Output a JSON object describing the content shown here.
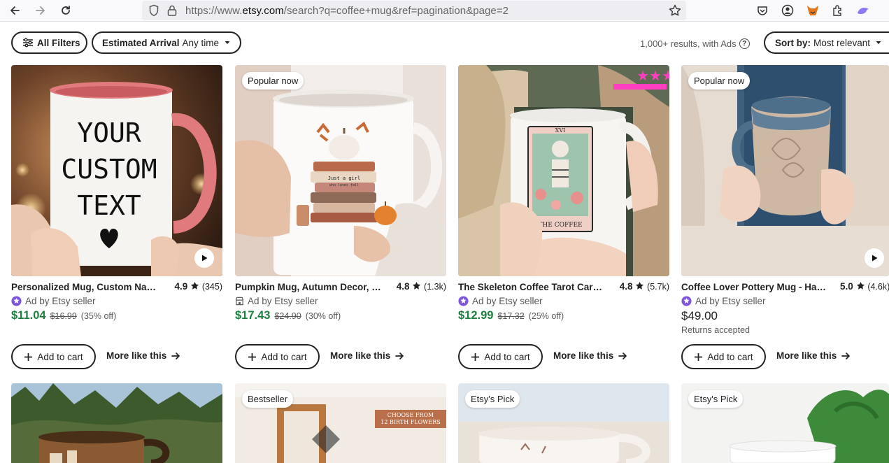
{
  "browser": {
    "url_prefix": "https://www.",
    "url_host": "etsy.com",
    "url_path": "/search?q=coffee+mug&ref=pagination&page=2"
  },
  "filters": {
    "all_filters": "All Filters",
    "arrival_label": "Estimated Arrival",
    "arrival_value": "Any time",
    "results_text": "1,000+ results, with Ads",
    "results_help": "?",
    "sort_label": "Sort by:",
    "sort_value": "Most relevant"
  },
  "listings": [
    {
      "title": "Personalized Mug, Custom Name Mug",
      "rating": "4.9",
      "reviews": "(345)",
      "seller_line": "Ad by Etsy seller",
      "price": "$11.04",
      "original_price": "$16.99",
      "discount": "(35% off)",
      "add_to_cart": "Add to cart",
      "more_like_this": "More like this",
      "mug_text": [
        "YOUR",
        "CUSTOM",
        "TEXT"
      ]
    },
    {
      "badge": "Popular now",
      "title": "Pumpkin Mug, Autumn Decor, Fall Mug",
      "rating": "4.8",
      "reviews": "(1.3k)",
      "seller_line": "Ad by Etsy seller",
      "price": "$17.43",
      "original_price": "$24.90",
      "discount": "(30% off)",
      "add_to_cart": "Add to cart",
      "more_like_this": "More like this",
      "mug_text": [
        "Just a girl",
        "who loves fall"
      ]
    },
    {
      "title": "The Skeleton Coffee Tarot Card Mug",
      "rating": "4.8",
      "reviews": "(5.7k)",
      "seller_line": "Ad by Etsy seller",
      "price": "$12.99",
      "original_price": "$17.32",
      "discount": "(25% off)",
      "add_to_cart": "Add to cart",
      "more_like_this": "More like this",
      "mug_text": [
        "XVI",
        "THE COFFEE"
      ]
    },
    {
      "badge": "Popular now",
      "title": "Coffee Lover Pottery Mug - Handmade",
      "rating": "5.0",
      "reviews": "(4.6k)",
      "seller_line": "Ad by Etsy seller",
      "price": "$49.00",
      "note": "Returns accepted",
      "add_to_cart": "Add to cart",
      "more_like_this": "More like this"
    }
  ],
  "second_row": [
    {
      "badge": ""
    },
    {
      "badge": "Bestseller",
      "overlay_text": [
        "CHOOSE FROM",
        "12 BIRTH FLOWERS"
      ]
    },
    {
      "badge": "Etsy's Pick"
    },
    {
      "badge": "Etsy's Pick"
    }
  ],
  "colors": {
    "sale_green": "#1c7f3e",
    "ad_star_purple": "#7f56d9",
    "text_dark": "#222222"
  }
}
